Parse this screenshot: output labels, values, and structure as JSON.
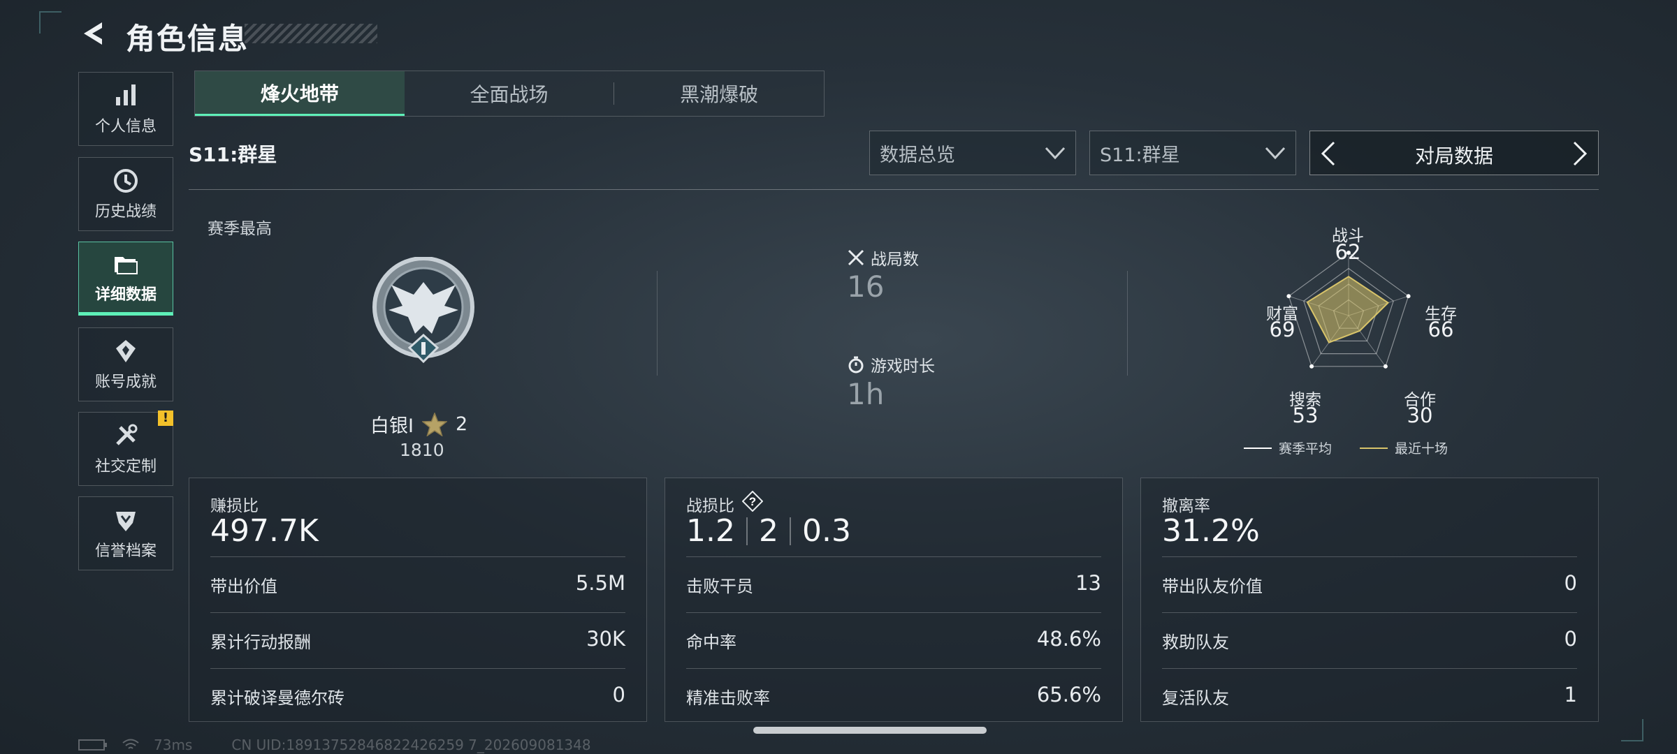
{
  "header": {
    "title": "角色信息",
    "back_icon": "back-arrow-icon"
  },
  "sidebar": {
    "items": [
      {
        "label": "个人信息",
        "icon": "bar-chart-icon",
        "active": false
      },
      {
        "label": "历史战绩",
        "icon": "clock-icon",
        "active": false
      },
      {
        "label": "详细数据",
        "icon": "folder-icon",
        "active": true
      },
      {
        "label": "账号成就",
        "icon": "medal-icon",
        "active": false
      },
      {
        "label": "社交定制",
        "icon": "tools-icon",
        "active": false,
        "badge": "!"
      },
      {
        "label": "信誉档案",
        "icon": "shield-icon",
        "active": false
      }
    ]
  },
  "tabs": [
    {
      "label": "烽火地带",
      "active": true
    },
    {
      "label": "全面战场",
      "active": false
    },
    {
      "label": "黑潮爆破",
      "active": false
    }
  ],
  "season_title": "S11:群星",
  "filters": {
    "dropdown1": "数据总览",
    "dropdown2": "S11:群星",
    "nav_label": "对局数据"
  },
  "summary": {
    "best_label": "赛季最高",
    "rank_name": "白银I",
    "rank_stars": "2",
    "rank_points": "1810",
    "matches_label": "战局数",
    "matches_value": "16",
    "playtime_label": "游戏时长",
    "playtime_value": "1h"
  },
  "radar": {
    "labels": {
      "combat": "战斗",
      "survival": "生存",
      "teamwork": "合作",
      "search": "搜索",
      "wealth": "财富"
    },
    "values": {
      "combat": "62",
      "survival": "66",
      "teamwork": "30",
      "search": "53",
      "wealth": "69"
    },
    "recent_ten": [
      62,
      66,
      30,
      53,
      69
    ],
    "legend": {
      "season_avg": "赛季平均",
      "recent_ten": "最近十场"
    },
    "colors": {
      "season_avg": "#ffffff",
      "recent_ten": "#d8c46a"
    }
  },
  "panels": {
    "profit": {
      "title": "赚损比",
      "value": "497.7K",
      "rows": [
        {
          "k": "带出价值",
          "v": "5.5M"
        },
        {
          "k": "累计行动报酬",
          "v": "30K"
        },
        {
          "k": "累计破译曼德尔砖",
          "v": "0"
        }
      ]
    },
    "combat": {
      "title": "战损比",
      "help": "?",
      "ratio": [
        "1.2",
        "2",
        "0.3"
      ],
      "rows": [
        {
          "k": "击败干员",
          "v": "13"
        },
        {
          "k": "命中率",
          "v": "48.6%"
        },
        {
          "k": "精准击败率",
          "v": "65.6%"
        }
      ]
    },
    "extract": {
      "title": "撤离率",
      "value": "31.2%",
      "rows": [
        {
          "k": "带出队友价值",
          "v": "0"
        },
        {
          "k": "救助队友",
          "v": "0"
        },
        {
          "k": "复活队友",
          "v": "1"
        }
      ]
    }
  },
  "footer": {
    "ping": "73ms",
    "uid": "CN UID:18913752846822426259 7_202609081348"
  },
  "accent": "#5ef0b8"
}
